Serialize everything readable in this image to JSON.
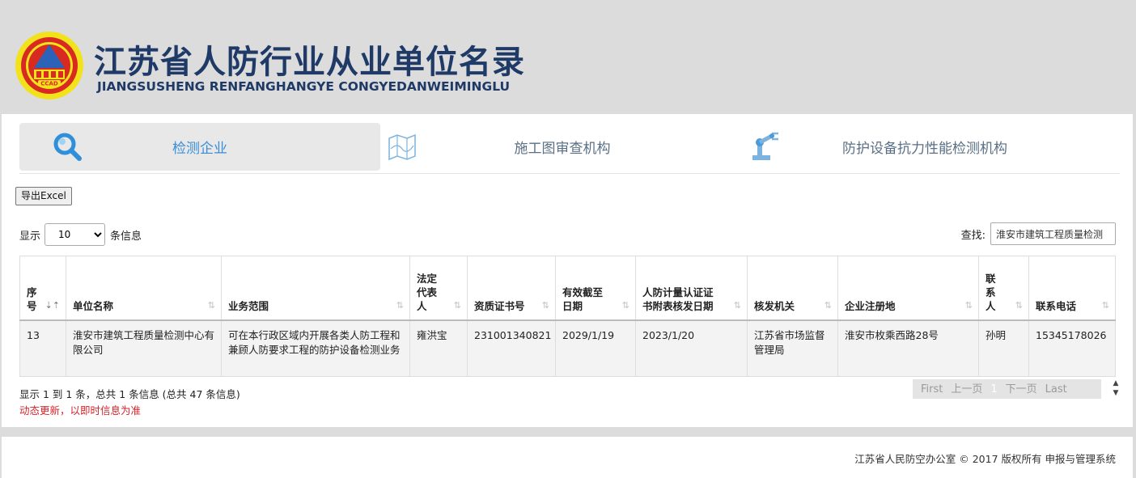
{
  "header": {
    "title_cn": "江苏省人防行业从业单位名录",
    "title_en": "JIANGSUSHENG RENFANGHANGYE CONGYEDANWEIMINGLU",
    "logo_text": "CCAD"
  },
  "tabs": [
    {
      "label": "检测企业",
      "icon": "magnifier-icon",
      "active": true
    },
    {
      "label": "施工图审查机构",
      "icon": "map-icon",
      "active": false
    },
    {
      "label": "防护设备抗力性能检测机构",
      "icon": "robot-arm-icon",
      "active": false
    }
  ],
  "toolbar": {
    "export_label": "导出Excel"
  },
  "length": {
    "prefix": "显示",
    "value": "10",
    "suffix": "条信息"
  },
  "search": {
    "label": "查找:",
    "value": "淮安市建筑工程质量检测"
  },
  "table": {
    "headers": [
      {
        "lines": [
          "序",
          "号"
        ],
        "sorted": true
      },
      {
        "lines": [
          "单位名称"
        ]
      },
      {
        "lines": [
          "业务范围"
        ]
      },
      {
        "lines": [
          "法定",
          "代表",
          "人"
        ]
      },
      {
        "lines": [
          "资质证书号"
        ]
      },
      {
        "lines": [
          "有效截至",
          "日期"
        ]
      },
      {
        "lines": [
          "人防计量认证证",
          "书附表核发日期"
        ]
      },
      {
        "lines": [
          "核发机关"
        ]
      },
      {
        "lines": [
          "企业注册地"
        ]
      },
      {
        "lines": [
          "联",
          "系",
          "人"
        ]
      },
      {
        "lines": [
          "联系电话"
        ]
      }
    ],
    "rows": [
      [
        "13",
        "淮安市建筑工程质量检测中心有限公司",
        "可在本行政区域内开展各类人防工程和兼顾人防要求工程的防护设备检测业务",
        "雍洪宝",
        "231001340821",
        "2029/1/19",
        "2023/1/20",
        "江苏省市场监督管理局",
        "淮安市枚乘西路28号",
        "孙明",
        "15345178026"
      ]
    ]
  },
  "info": {
    "summary": "显示 1 到 1 条，总共 1 条信息 (总共 47 条信息)",
    "note": "动态更新，以即时信息为准"
  },
  "pager": {
    "first": "First",
    "prev": "上一页",
    "current": "1",
    "next": "下一页",
    "last": "Last"
  },
  "footer": {
    "copyright": "江苏省人民防空办公室 © 2017 版权所有 申报与管理系统"
  }
}
